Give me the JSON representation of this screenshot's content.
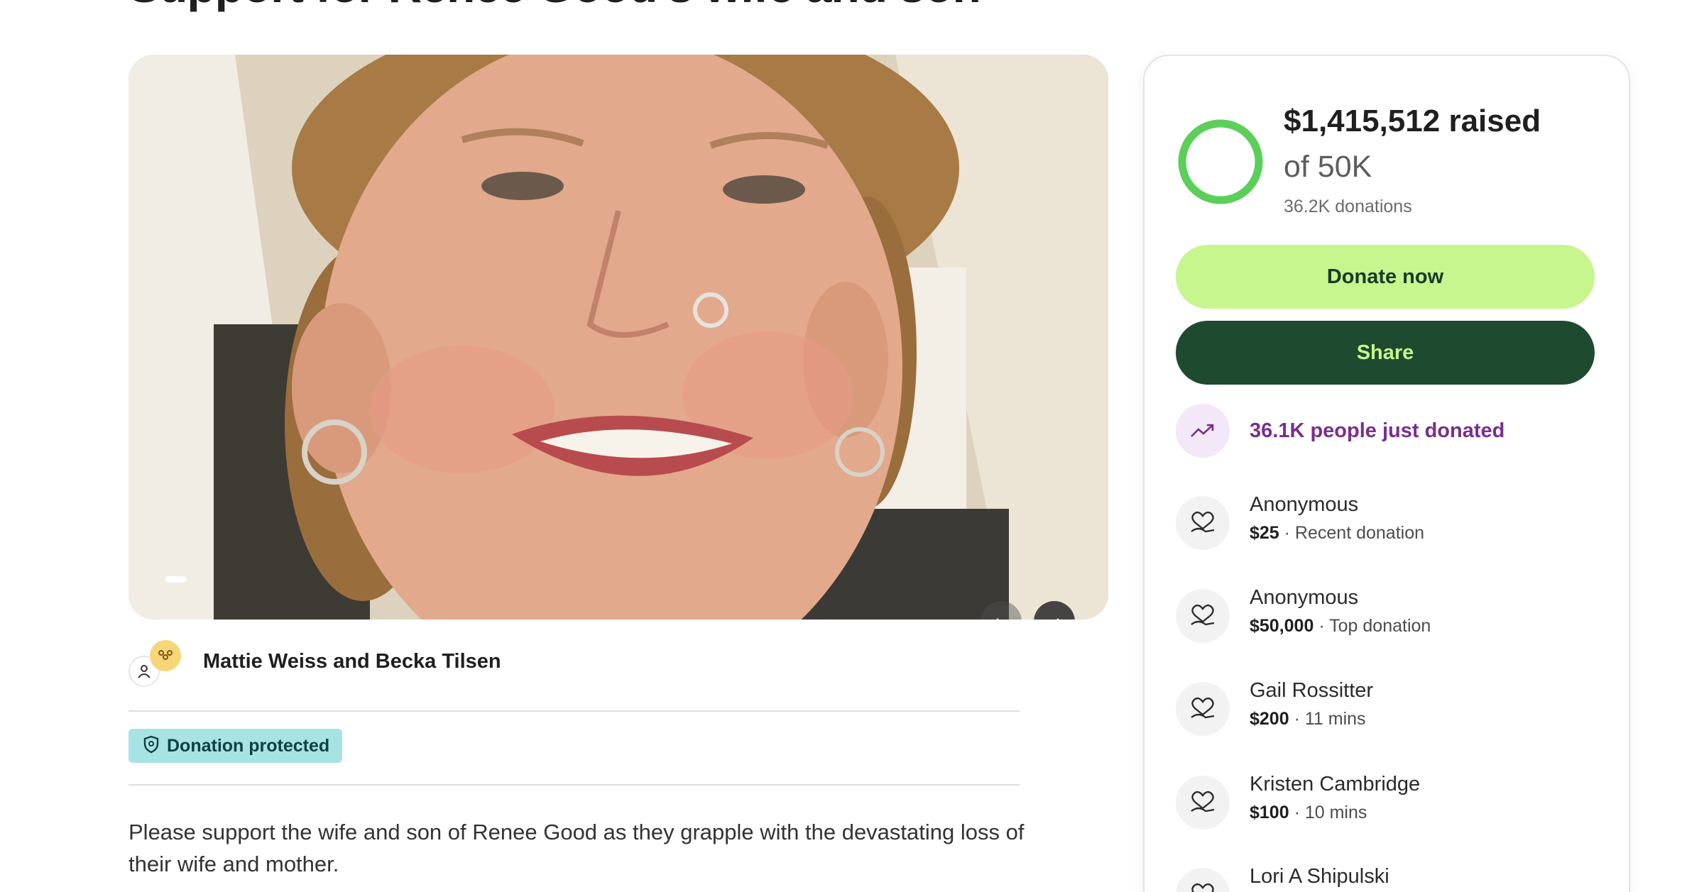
{
  "page": {
    "title": "Support for Renee Good's wife and son"
  },
  "hero": {
    "prev_icon": "arrow-left-icon",
    "next_icon": "arrow-right-icon",
    "slide_indicator_active": 1
  },
  "organizer": {
    "names": "Mattie Weiss and Becka Tilsen",
    "avatar_icons": [
      "person-icon",
      "group-icon"
    ]
  },
  "badge": {
    "label": "Donation protected",
    "icon": "shield-icon",
    "color": "#a8e3e3"
  },
  "story": {
    "text": "Please support the wife and son of Renee Good as they grapple with the devastating loss of their wife and mother."
  },
  "summary": {
    "raised": "$1,415,512 raised",
    "goal": "of 50K",
    "donations": "36.2K donations",
    "progress_fraction": 1.0,
    "progress_color": "#5ccf5a"
  },
  "actions": {
    "donate_label": "Donate now",
    "share_label": "Share",
    "donate_color": "#c6f68d",
    "share_color": "#1e4a2f"
  },
  "trend": {
    "label": "36.1K people just donated",
    "icon": "trending-up-icon",
    "color": "#7a2d8f"
  },
  "donations": [
    {
      "name": "Anonymous",
      "amount": "$25",
      "meta": " · Recent donation"
    },
    {
      "name": "Anonymous",
      "amount": "$50,000",
      "meta": " · Top donation"
    },
    {
      "name": "Gail Rossitter",
      "amount": "$200",
      "meta": " · 11 mins"
    },
    {
      "name": "Kristen Cambridge",
      "amount": "$100",
      "meta": " · 10 mins"
    },
    {
      "name": "Lori A Shipulski",
      "amount": "",
      "meta": ""
    }
  ],
  "donor_icon": "heart-hand-icon"
}
